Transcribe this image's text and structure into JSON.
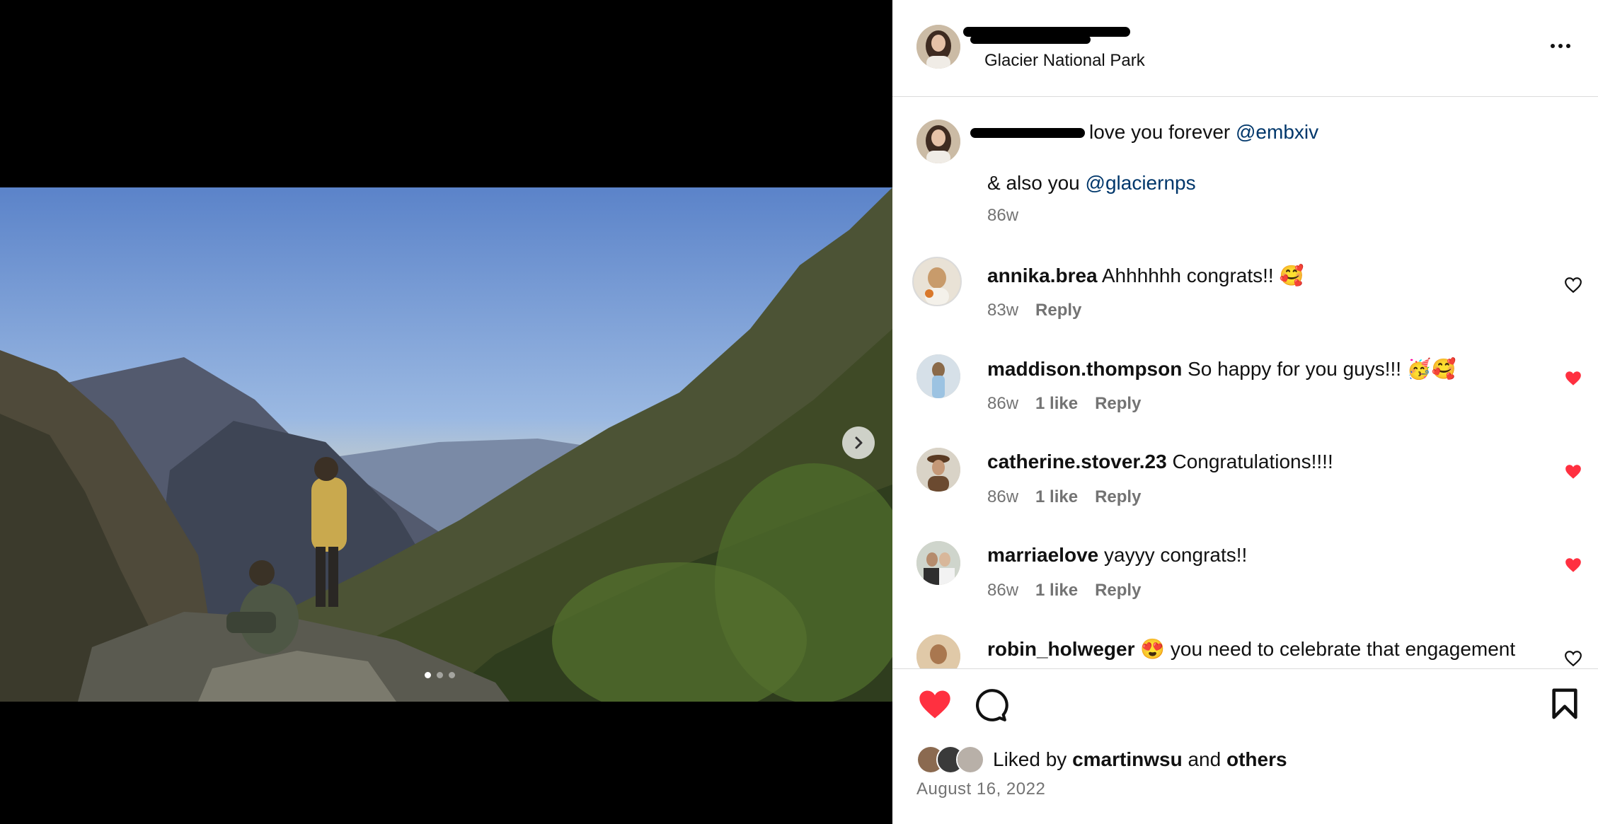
{
  "post": {
    "location": "Glacier National Park",
    "date": "August 16, 2022",
    "carousel": {
      "total": 3,
      "current": 1
    }
  },
  "caption": {
    "text1": "love you forever",
    "mention1": "@embxiv",
    "text2": "& also you",
    "mention2": "@glaciernps",
    "time": "86w"
  },
  "comments": [
    {
      "user": "annika.brea",
      "text": "Ahhhhhh congrats!! 🥰",
      "time": "83w",
      "likes": "",
      "reply": "Reply",
      "liked": false
    },
    {
      "user": "maddison.thompson",
      "text": "So happy for you guys!!! 🥳🥰",
      "time": "86w",
      "likes": "1 like",
      "reply": "Reply",
      "liked": true
    },
    {
      "user": "catherine.stover.23",
      "text": "Congratulations!!!!",
      "time": "86w",
      "likes": "1 like",
      "reply": "Reply",
      "liked": true
    },
    {
      "user": "marriaelove",
      "text": "yayyy congrats!!",
      "time": "86w",
      "likes": "1 like",
      "reply": "Reply",
      "liked": true
    },
    {
      "user": "robin_holweger",
      "text": "😍 you need to celebrate that engagement",
      "time": "",
      "likes": "",
      "reply": "",
      "liked": false
    }
  ],
  "likes": {
    "prefix": "Liked by",
    "user": "cmartinwsu",
    "middle": "and",
    "others": "others"
  },
  "colors": {
    "like_red": "#ff3040",
    "mention_blue": "#00376b",
    "muted": "#737373"
  },
  "icons": [
    "chevron-right-icon",
    "more-horizontal-icon",
    "heart-icon",
    "comment-icon",
    "bookmark-icon"
  ]
}
